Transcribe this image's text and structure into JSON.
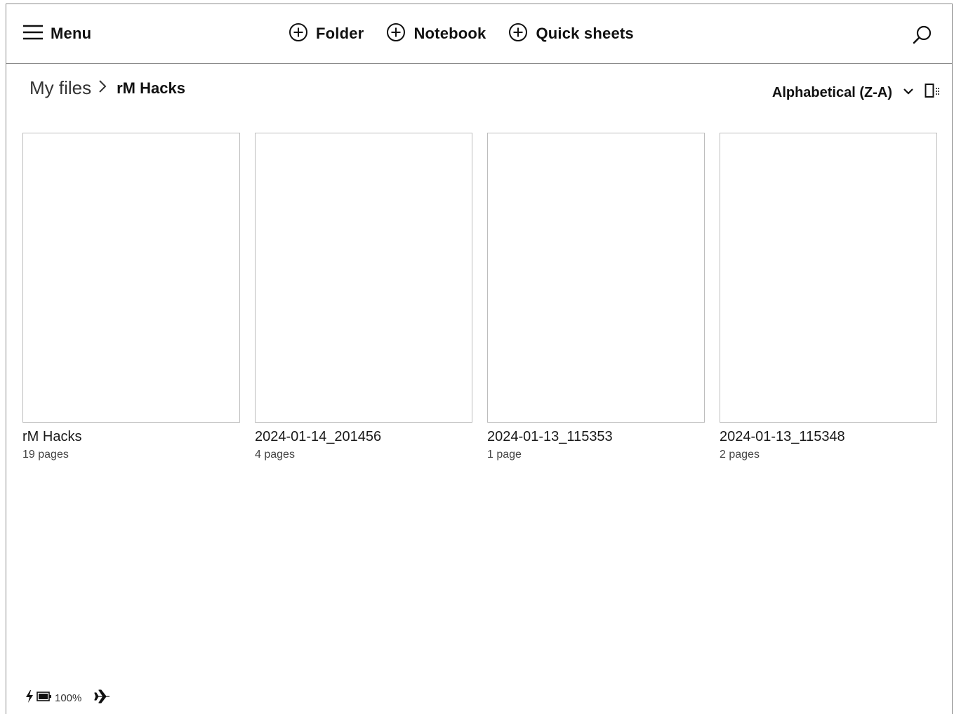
{
  "topbar": {
    "menu_label": "Menu",
    "actions": [
      {
        "label": "Folder",
        "icon": "plus-circle-icon"
      },
      {
        "label": "Notebook",
        "icon": "plus-circle-icon"
      },
      {
        "label": "Quick sheets",
        "icon": "plus-circle-icon"
      }
    ],
    "search_icon": "search-icon"
  },
  "breadcrumb": {
    "root": "My files",
    "separator": ">",
    "current": "rM Hacks"
  },
  "sort": {
    "label": "Alphabetical (Z-A)",
    "dropdown_icon": "chevron-down-icon",
    "view_icon": "view-toggle-icon"
  },
  "documents": [
    {
      "name": "rM Hacks",
      "pages": "19 pages"
    },
    {
      "name": "2024-01-14_201456",
      "pages": "4 pages"
    },
    {
      "name": "2024-01-13_115353",
      "pages": "1 page"
    },
    {
      "name": "2024-01-13_115348",
      "pages": "2 pages"
    }
  ],
  "status": {
    "battery_percent": "100%",
    "charging_icon": "lightning-icon",
    "battery_icon": "battery-icon",
    "airplane_icon": "airplane-icon"
  }
}
